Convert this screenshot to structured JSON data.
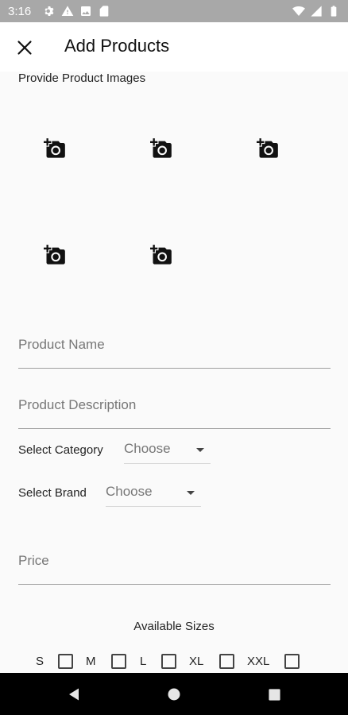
{
  "status_bar": {
    "time": "3:16",
    "left_icons": [
      "gear-icon",
      "warning-icon",
      "image-icon",
      "sd-card-icon"
    ],
    "right_icons": [
      "wifi-icon",
      "cellular-icon",
      "battery-icon"
    ]
  },
  "app_bar": {
    "title": "Add Products",
    "close_icon": "close-icon"
  },
  "images_section": {
    "label": "Provide Product Images",
    "slot_icon": "add-a-photo-icon"
  },
  "form": {
    "product_name_placeholder": "Product Name",
    "product_description_placeholder": "Product Description",
    "category_label": "Select Category",
    "category_value": "Choose",
    "brand_label": "Select Brand",
    "brand_value": "Choose",
    "price_placeholder": "Price"
  },
  "sizes": {
    "title": "Available Sizes",
    "options": [
      "S",
      "M",
      "L",
      "XL",
      "XXL"
    ]
  },
  "nav_bar": {
    "buttons": [
      "back-icon",
      "home-icon",
      "recents-icon"
    ]
  },
  "colors": {
    "status_bar": "#a8a8a8",
    "background": "#fafafa",
    "app_bar": "#ffffff",
    "nav_bar": "#000000"
  }
}
